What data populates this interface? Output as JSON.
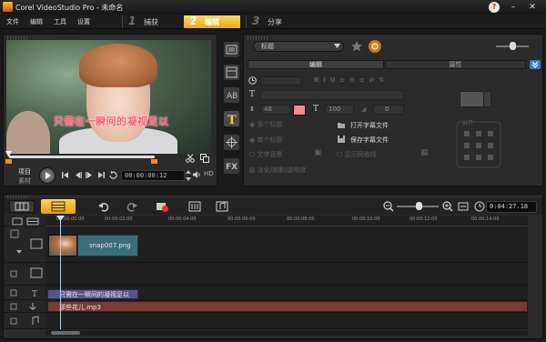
{
  "window": {
    "title": "Corel VideoStudio Pro - 未命名",
    "help_label": "?",
    "minimize_label": "–",
    "close_label": "✕"
  },
  "menu": {
    "items": [
      "文件",
      "编辑",
      "工具",
      "设置"
    ]
  },
  "steps": [
    {
      "num": "1",
      "label": "捕获",
      "active": false
    },
    {
      "num": "2",
      "label": "编辑",
      "active": true
    },
    {
      "num": "3",
      "label": "分享",
      "active": false
    }
  ],
  "player": {
    "overlay_text": "只需在一瞬间的凝视足以",
    "mode_project": "项目",
    "mode_clip": "素材",
    "timecode": "00:00:00:12",
    "hd_label": "HD"
  },
  "options": {
    "title_select": "标题",
    "tab_edit": "编辑",
    "tab_attributes": "属性",
    "font_size": "48",
    "line_spacing": "100",
    "angle": "0",
    "multi_title": "多个标题",
    "single_title": "单个标题",
    "text_background": "文字背景",
    "show_grid": "显示网格线",
    "fade": "淡化/阴影/透明度",
    "open_subtitle": "打开字幕文件",
    "save_subtitle": "保存字幕文件",
    "alignment_label": "对齐",
    "text_color": "#f58a8c"
  },
  "timeline": {
    "timecode": "0:04:27.18",
    "ruler": [
      "00:00:00:00",
      "00:00:02:00",
      "00:00:04:00",
      "00:00:06:00",
      "00:00:08:00",
      "00:00:10:00",
      "00:00:12:00",
      "00:00:14:00"
    ],
    "image_clip": "snap007.png",
    "title_clip": "只需在一瞬间的凝视足以",
    "music_clip": "那些花儿.mp3"
  },
  "icons": {
    "accent": "#f0b323",
    "music_clip_color": "#7a3a31",
    "title_clip_color": "#56558a",
    "image_clip_color": "#3c6e7a"
  }
}
